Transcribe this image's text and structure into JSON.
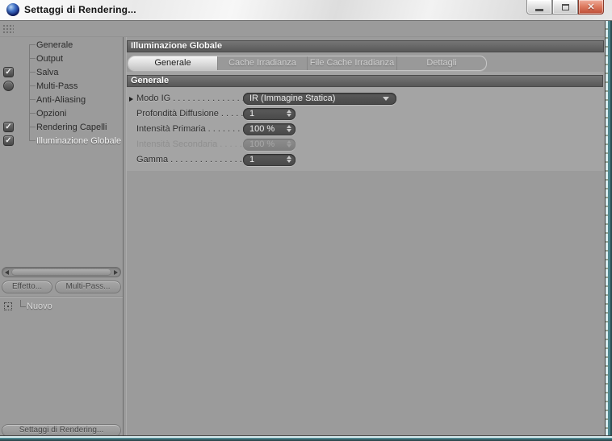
{
  "window": {
    "title": "Settaggi di Rendering...",
    "controls": [
      {
        "name": "minimize"
      },
      {
        "name": "maximize"
      },
      {
        "name": "close",
        "glyph": "✕"
      }
    ]
  },
  "sidebar": {
    "items": [
      {
        "label": "Generale"
      },
      {
        "label": "Output"
      },
      {
        "label": "Salva",
        "checkbox": "checked"
      },
      {
        "label": "Multi-Pass",
        "checkbox": "unchecked",
        "checkbox_shape": "round"
      },
      {
        "label": "Anti-Aliasing"
      },
      {
        "label": "Opzioni"
      },
      {
        "label": "Rendering Capelli",
        "checkbox": "checked"
      },
      {
        "label": "Illuminazione Globale",
        "checkbox": "checked",
        "selected": true
      }
    ],
    "buttons": {
      "effect": "Effetto...",
      "multipass": "Multi-Pass...",
      "render_settings": "Settaggi di Rendering..."
    },
    "effects_list": [
      {
        "label": "Nuovo"
      }
    ]
  },
  "main": {
    "panel_title": "Illuminazione Globale",
    "tabs": [
      {
        "label": "Generale",
        "active": true
      },
      {
        "label": "Cache Irradianza",
        "active": false
      },
      {
        "label": "File Cache Irradianza",
        "active": false
      },
      {
        "label": "Dettagli",
        "active": false
      }
    ],
    "section_title": "Generale",
    "fields": [
      {
        "label": "Modo IG",
        "type": "dropdown",
        "value": "IR (Immagine Statica)",
        "expander": true,
        "enabled": true
      },
      {
        "label": "Profondità Diffusione",
        "type": "spinner",
        "value": "1",
        "enabled": true
      },
      {
        "label": "Intensità Primaria",
        "type": "spinner",
        "value": "100 %",
        "enabled": true
      },
      {
        "label": "Intensità Secondaria",
        "type": "spinner",
        "value": "100 %",
        "enabled": false
      },
      {
        "label": "Gamma",
        "type": "spinner",
        "value": "1",
        "enabled": true
      }
    ]
  },
  "colors": {
    "app_background": "#9b9b9b",
    "form_background": "#a4a4a4",
    "dark_bar": "#5d5d5d",
    "field_background": "#4f4f4f",
    "active_tab": "#e3e3e3",
    "selected_item_text": "#f4f4f4",
    "close_button_red": "#cf6450",
    "window_edge_teal": "#4e868e"
  }
}
